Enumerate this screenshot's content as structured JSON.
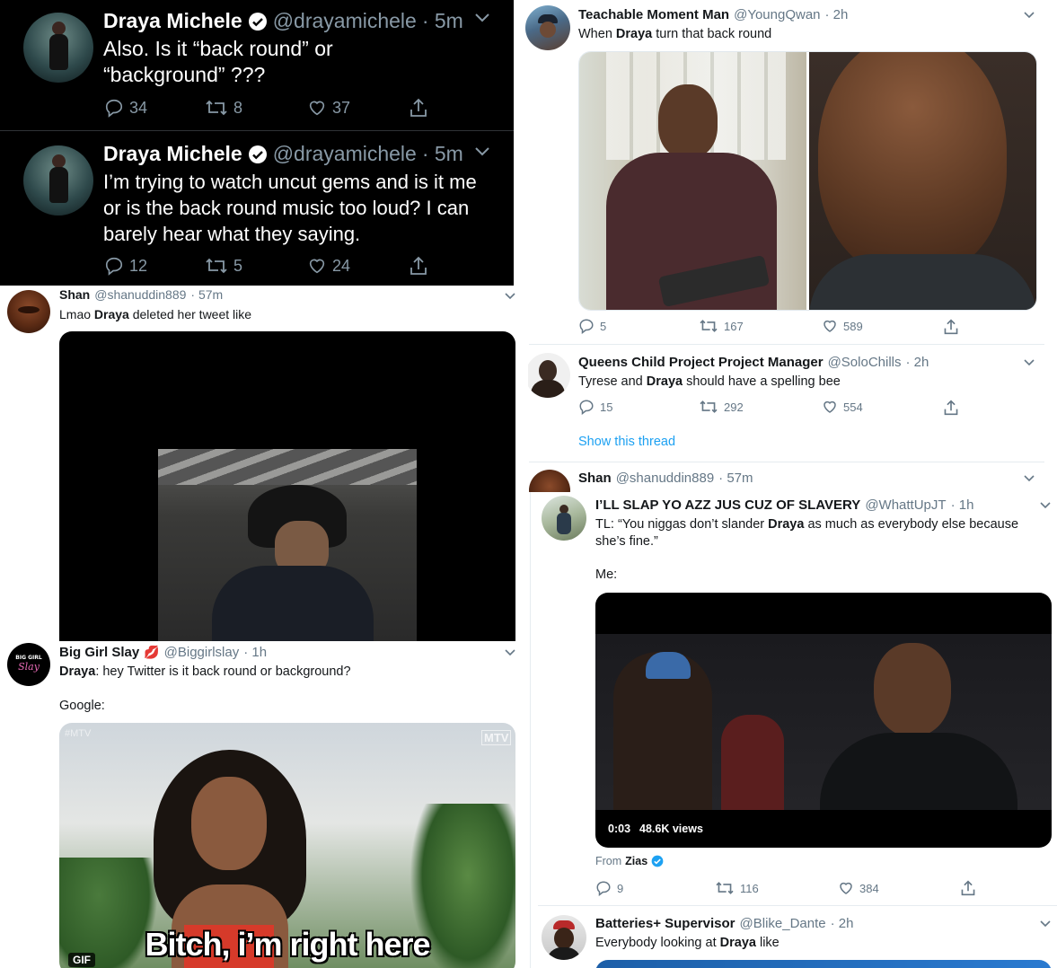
{
  "t1": {
    "name": "Draya Michele",
    "handle": "@drayamichele",
    "time": "· 5m",
    "text": "Also.   Is it “back round” or “background” ???",
    "replies": "34",
    "retweets": "8",
    "likes": "37"
  },
  "t2": {
    "name": "Draya Michele",
    "handle": "@drayamichele",
    "time": "· 5m",
    "text": "I’m trying to watch uncut gems and is it me or is the back round music too loud? I can barely hear what they saying.",
    "replies": "12",
    "retweets": "5",
    "likes": "24"
  },
  "t3": {
    "name": "Teachable Moment Man",
    "handle": "@YoungQwan",
    "time": "· 2h",
    "text_pre": "When ",
    "text_bold": "Draya",
    "text_post": " turn that back round",
    "replies": "5",
    "retweets": "167",
    "likes": "589"
  },
  "t4": {
    "name": "Queens Child Project Project Manager",
    "handle": "@SoloChills",
    "time": "· 2h",
    "text_pre": "Tyrese and ",
    "text_bold": "Draya",
    "text_post": " should have a spelling bee",
    "replies": "15",
    "retweets": "292",
    "likes": "554",
    "thread_link": "Show this thread"
  },
  "t5": {
    "name": "Shan",
    "handle": "@shanuddin889",
    "time": "· 57m"
  },
  "t6": {
    "name": "Shan",
    "handle": "@shanuddin889",
    "time": "· 57m",
    "text_pre": "Lmao ",
    "text_bold": "Draya",
    "text_post": " deleted her tweet like"
  },
  "t7": {
    "name": "Big Girl Slay",
    "emoji": "💋",
    "handle": "@Biggirlslay",
    "time": "· 1h",
    "text_bold": "Draya",
    "text_post": ": hey Twitter is it back round or background?",
    "text2": "Google:",
    "avatar_text": "BIG GIRL",
    "avatar_script": "Slay",
    "gif_caption": "Bitch, i’m right here",
    "gif_badge": "GIF",
    "watermark": "#MTV",
    "watermark2": "MTV"
  },
  "t8": {
    "name": "I’LL SLAP YO AZZ JUS CUZ OF SLAVERY",
    "handle": "@WhattUpJT",
    "time": "· 1h",
    "text_pre": "TL: “You niggas don’t slander ",
    "text_bold": "Draya",
    "text_post": " as much as everybody else because she’s fine.”",
    "text2": "Me:",
    "video_time": "0:03",
    "video_views": "48.6K views",
    "from_label": "From",
    "from_name": "Zias",
    "replies": "9",
    "retweets": "116",
    "likes": "384"
  },
  "t9": {
    "name": "Batteries+ Supervisor",
    "handle": "@Blike_Dante",
    "time": "· 2h",
    "text_pre": "Everybody looking at ",
    "text_bold": "Draya",
    "text_post": " like"
  },
  "colors": {
    "link": "#1da1f2",
    "verified": "#1da1f2",
    "muted": "#657786",
    "lips": "#e0245e"
  }
}
